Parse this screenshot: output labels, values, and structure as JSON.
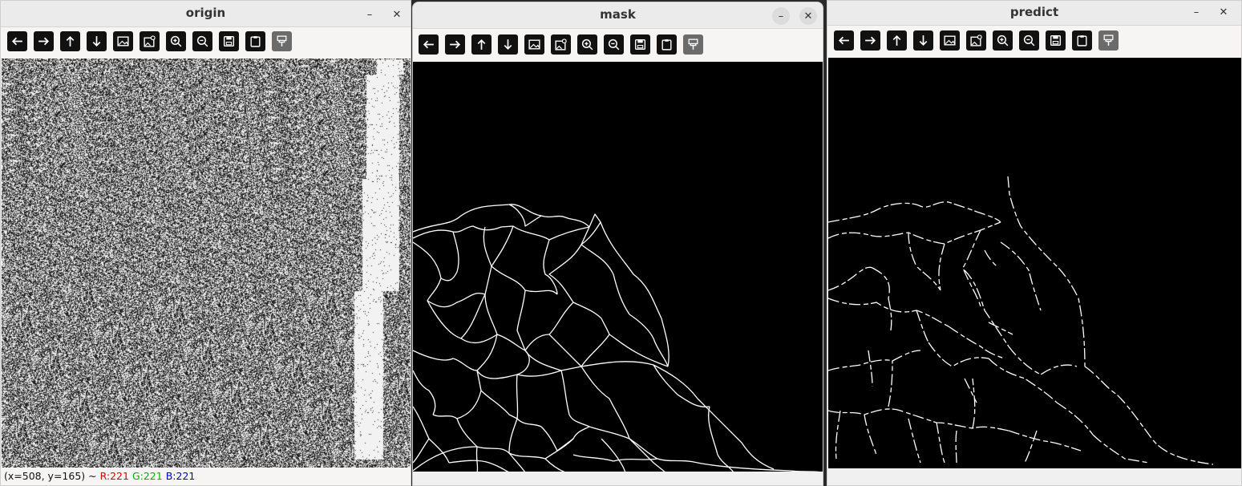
{
  "windows": {
    "origin": {
      "title": "origin"
    },
    "mask": {
      "title": "mask"
    },
    "predict": {
      "title": "predict"
    }
  },
  "window_controls": {
    "minimize": "–",
    "close": "✕"
  },
  "toolbar_icons": [
    "arrow-left-icon",
    "arrow-right-icon",
    "arrow-up-icon",
    "arrow-down-icon",
    "image-icon",
    "image-edit-icon",
    "zoom-in-icon",
    "zoom-out-icon",
    "save-icon",
    "clipboard-icon",
    "brush-icon"
  ],
  "status": {
    "coords": "(x=508, y=165) ~ ",
    "r": "R:221",
    "g": "G:221",
    "b": "B:221"
  },
  "colors": {
    "status_r": "#e00000",
    "status_g": "#00b000",
    "status_b": "#0000d0"
  }
}
